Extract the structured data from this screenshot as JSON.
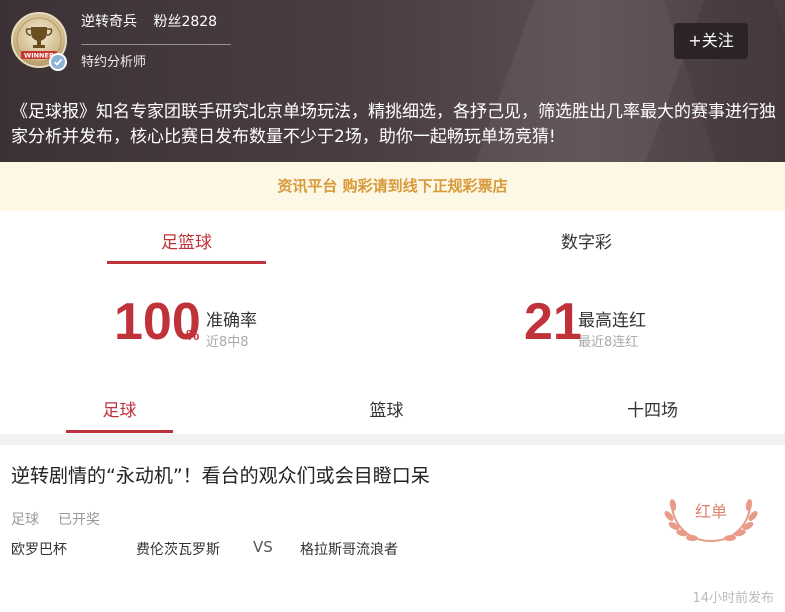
{
  "header": {
    "username": "逆转奇兵",
    "fans": "粉丝2828",
    "role": "特约分析师",
    "follow_label": "+关注",
    "description": "《足球报》知名专家团联手研究北京单场玩法，精挑细选，各抒己见，筛选胜出几率最大的赛事进行独家分析并发布，核心比赛日发布数量不少于2场，助你一起畅玩单场竞猜!"
  },
  "notice": "资讯平台 购彩请到线下正规彩票店",
  "top_tabs": [
    {
      "label": "足篮球",
      "active": true
    },
    {
      "label": "数字彩",
      "active": false
    }
  ],
  "stats": {
    "accuracy": {
      "value": "100",
      "unit": "%",
      "label": "准确率",
      "sub": "近8中8"
    },
    "streak": {
      "value": "21",
      "label": "最高连红",
      "sub": "最近8连红"
    }
  },
  "sport_tabs": [
    {
      "label": "足球",
      "active": true
    },
    {
      "label": "篮球",
      "active": false
    },
    {
      "label": "十四场",
      "active": false
    }
  ],
  "article": {
    "title": "逆转剧情的“永动机”！看台的观众们或会目瞪口呆",
    "category": "足球",
    "status": "已开奖",
    "league": "欧罗巴杯",
    "home_team": "费伦茨瓦罗斯",
    "vs": "VS",
    "away_team": "格拉斯哥流浪者",
    "badge": "红单",
    "time": "14小时前发布"
  },
  "colors": {
    "accent": "#c0323a",
    "notice_bg": "#fdf8e6",
    "notice_text": "#d89a3a",
    "badge": "#e0826f"
  },
  "icons": [
    "avatar-trophy-icon",
    "verified-check-icon",
    "laurel-wreath-icon"
  ]
}
